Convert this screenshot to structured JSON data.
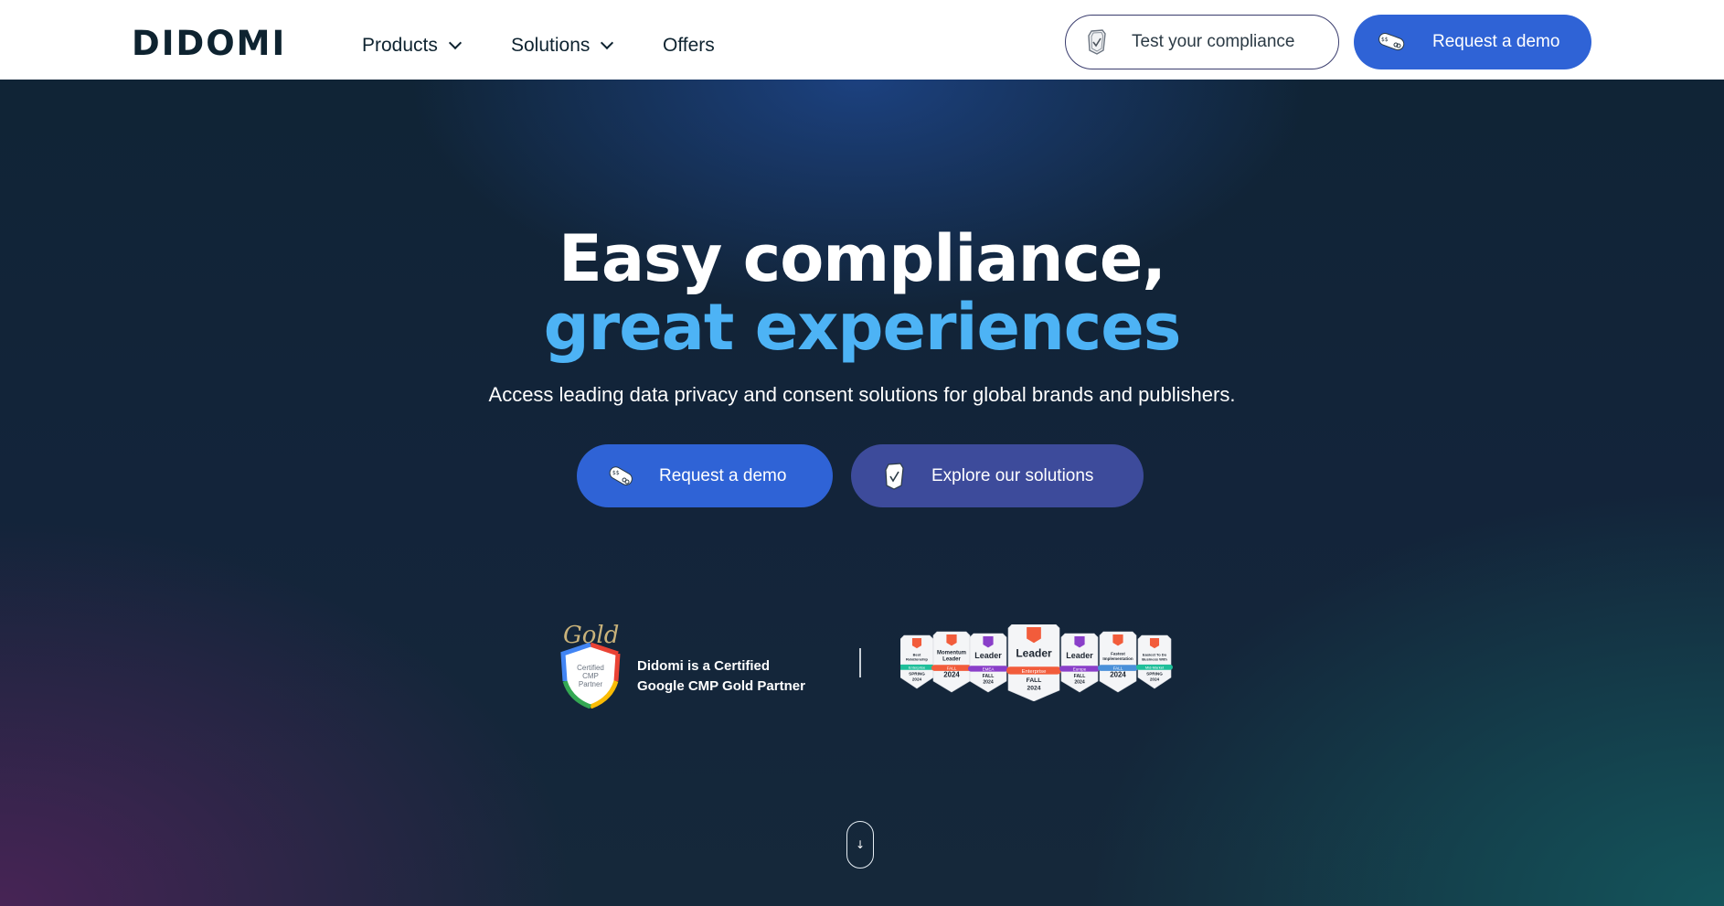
{
  "nav": {
    "logo": "DIDOMI",
    "items": [
      {
        "label": "Products",
        "has_dropdown": true
      },
      {
        "label": "Solutions",
        "has_dropdown": true
      },
      {
        "label": "Offers",
        "has_dropdown": false
      }
    ],
    "test_compliance": {
      "label": "Test your compliance",
      "icon": "shield-check-icon"
    },
    "request_demo": {
      "label": "Request a demo",
      "icon": "gamepad-icon"
    }
  },
  "hero": {
    "title_line1": "Easy compliance,",
    "title_line2": "great experiences",
    "subtitle": "Access leading data privacy and consent solutions for global brands and publishers.",
    "buttons": [
      {
        "label": "Request a demo",
        "icon": "gamepad-icon"
      },
      {
        "label": "Explore our solutions",
        "icon": "shield-check-icon"
      }
    ]
  },
  "certification": {
    "badge_script": "Gold",
    "badge_lines": [
      "Certified",
      "CMP",
      "Partner"
    ],
    "text_line1": "Didomi is a Certified",
    "text_line2": "Google CMP Gold Partner"
  },
  "g2_badges": [
    {
      "title": "Best Relationship",
      "band": "Enterprise",
      "season": "SPRING",
      "year": "2024",
      "band_color": "#1fbf9a",
      "logo_color": "#f25c3b"
    },
    {
      "title": "Momentum Leader",
      "band": "FALL",
      "season": "",
      "year": "2024",
      "band_color": "#f25c3b",
      "logo_color": "#f25c3b"
    },
    {
      "title": "Leader",
      "band": "EMEA",
      "season": "FALL",
      "year": "2024",
      "band_color": "#8a3fc9",
      "logo_color": "#8a3fc9"
    },
    {
      "title": "Leader",
      "band": "Enterprise",
      "season": "FALL",
      "year": "2024",
      "band_color": "#f25c3b",
      "logo_color": "#f25c3b"
    },
    {
      "title": "Leader",
      "band": "Europe",
      "season": "FALL",
      "year": "2024",
      "band_color": "#8a3fc9",
      "logo_color": "#8a3fc9"
    },
    {
      "title": "Fastest Implementation",
      "band": "FALL",
      "season": "",
      "year": "2024",
      "band_color": "#4a90d9",
      "logo_color": "#f25c3b"
    },
    {
      "title": "Easiest To Do Business With",
      "band": "Mid-Market",
      "season": "SPRING",
      "year": "2024",
      "band_color": "#1fbf9a",
      "logo_color": "#f25c3b"
    }
  ],
  "scroll_indicator": {
    "icon": "arrow-down-icon",
    "glyph": "↓"
  },
  "colors": {
    "primary_blue": "#2f63d6",
    "secondary_indigo": "#3d4b9b",
    "accent_sky": "#4db3f5",
    "navy": "#0e2330"
  }
}
